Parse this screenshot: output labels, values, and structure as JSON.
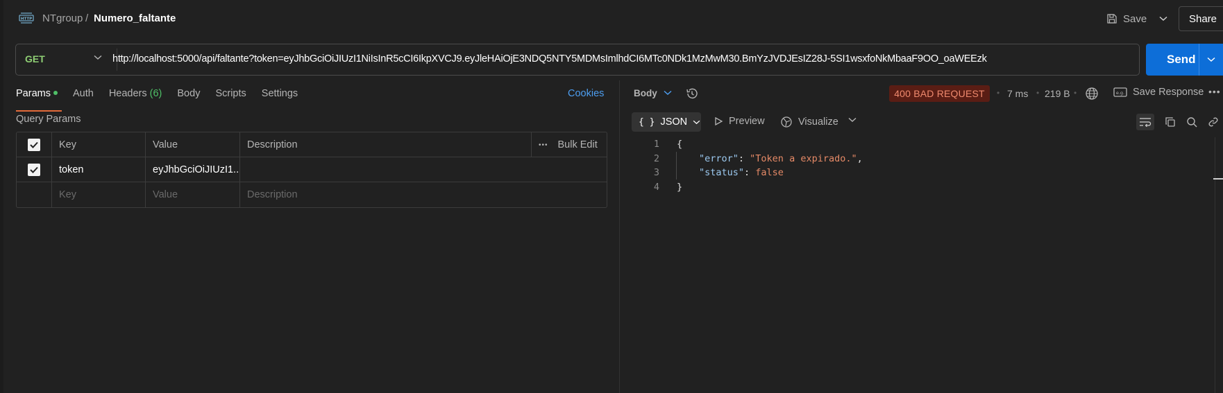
{
  "header": {
    "breadcrumb_parent": "NTgroup",
    "breadcrumb_separator": "/",
    "request_name": "Numero_faltante",
    "save_label": "Save",
    "share_label": "Share"
  },
  "request": {
    "method": "GET",
    "url": "http://localhost:5000/api/faltante?token=eyJhbGciOiJIUzI1NiIsInR5cCI6IkpXVCJ9.eyJleHAiOjE3NDQ5NTY5MDMsImlhdCI6MTc0NDk1MzMwM30.BmYzJVDJEsIZ28J-5SI1wsxfoNkMbaaF9OO_oaWEEzk",
    "send_label": "Send"
  },
  "tabs": {
    "params": "Params",
    "auth": "Auth",
    "headers": "Headers",
    "headers_count": "(6)",
    "body": "Body",
    "scripts": "Scripts",
    "settings": "Settings",
    "cookies": "Cookies"
  },
  "query_params": {
    "title": "Query Params",
    "columns": {
      "key": "Key",
      "value": "Value",
      "description": "Description",
      "bulk_edit": "Bulk Edit"
    },
    "rows": [
      {
        "key": "token",
        "value": "eyJhbGciOiJIUzI1...",
        "description": "",
        "checked": true
      }
    ],
    "placeholders": {
      "key": "Key",
      "value": "Value",
      "description": "Description"
    }
  },
  "response": {
    "body_label": "Body",
    "status": "400 BAD REQUEST",
    "time": "7 ms",
    "size": "219 B",
    "save_response": "Save Response",
    "format": "JSON",
    "preview": "Preview",
    "visualize": "Visualize",
    "lines": [
      "1",
      "2",
      "3",
      "4"
    ],
    "json": {
      "open": "{",
      "error_key": "\"error\"",
      "error_value": "\"Token a expirado.\"",
      "status_key": "\"status\"",
      "status_value": "false",
      "close": "}"
    }
  },
  "colors": {
    "accent_orange": "#e36b3a",
    "send_blue": "#0d6ed8",
    "method_green": "#8fcf74",
    "error_badge_bg": "#5a1d14",
    "error_badge_text": "#f08a6e"
  }
}
